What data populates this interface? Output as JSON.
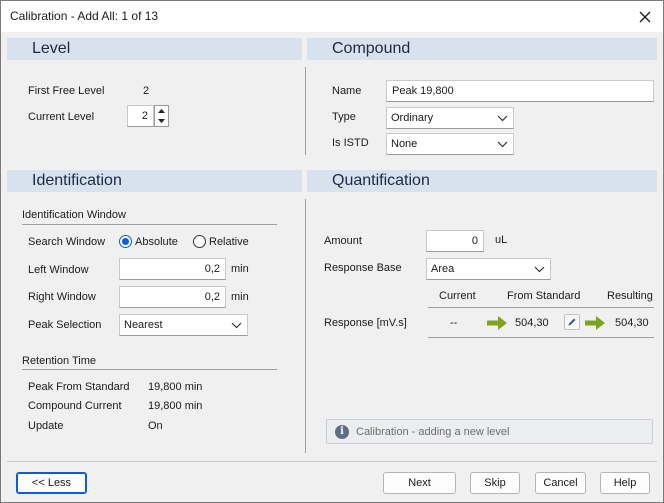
{
  "window": {
    "title": "Calibration - Add All: 1 of 13"
  },
  "level": {
    "header": "Level",
    "first_free_label": "First Free Level",
    "first_free_value": "2",
    "current_label": "Current Level",
    "current_value": "2"
  },
  "compound": {
    "header": "Compound",
    "name_label": "Name",
    "name_value": "Peak 19,800",
    "type_label": "Type",
    "type_value": "Ordinary",
    "istd_label": "Is ISTD",
    "istd_value": "None"
  },
  "identification": {
    "header": "Identification",
    "window_group": "Identification Window",
    "search_window_label": "Search Window",
    "search_absolute": "Absolute",
    "search_relative": "Relative",
    "search_selected": "Absolute",
    "left_window_label": "Left Window",
    "left_window_value": "0,2",
    "left_window_unit": "min",
    "right_window_label": "Right Window",
    "right_window_value": "0,2",
    "right_window_unit": "min",
    "peak_selection_label": "Peak Selection",
    "peak_selection_value": "Nearest",
    "retention_group": "Retention Time",
    "peak_from_standard_label": "Peak From Standard",
    "peak_from_standard_value": "19,800 min",
    "compound_current_label": "Compound Current",
    "compound_current_value": "19,800 min",
    "update_label": "Update",
    "update_value": "On"
  },
  "quantification": {
    "header": "Quantification",
    "amount_label": "Amount",
    "amount_value": "0",
    "amount_unit": "uL",
    "response_base_label": "Response Base",
    "response_base_value": "Area",
    "col_current": "Current",
    "col_from_standard": "From Standard",
    "col_resulting": "Resulting",
    "response_label": "Response [mV.s]",
    "response_current": "--",
    "response_from_standard": "504,30",
    "response_resulting": "504,30",
    "info_text": "Calibration - adding a new level"
  },
  "buttons": {
    "less": "<< Less",
    "next": "Next",
    "skip": "Skip",
    "cancel": "Cancel",
    "help": "Help"
  },
  "colors": {
    "section_header_bg": "#d8e2ee",
    "accent": "#0a5ed7",
    "arrow_green": "#7ea31e"
  }
}
